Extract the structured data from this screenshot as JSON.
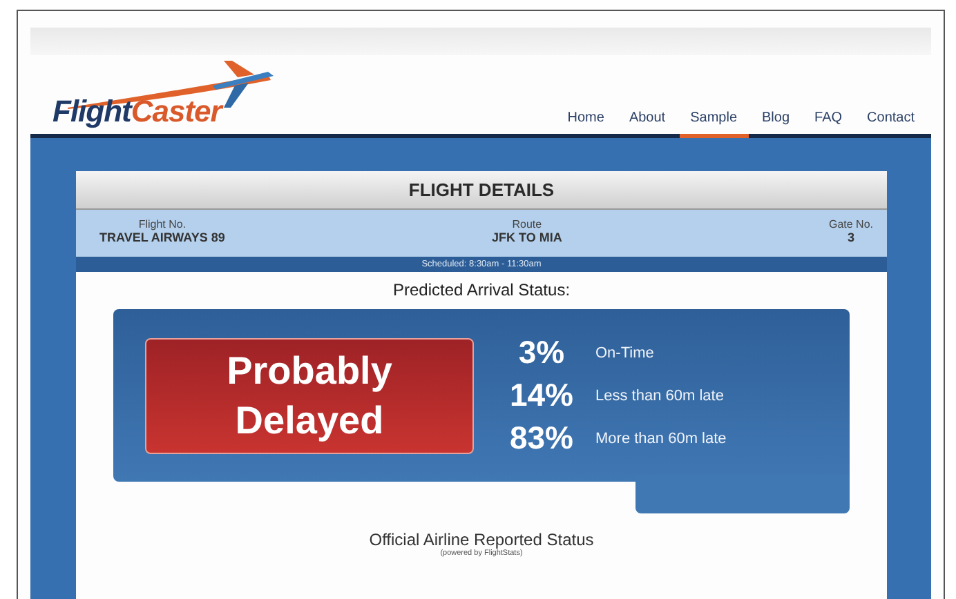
{
  "logo": {
    "part_1": "Flight",
    "part_2": "Caster"
  },
  "nav": [
    {
      "label": "Home",
      "selected": false
    },
    {
      "label": "About",
      "selected": false
    },
    {
      "label": "Sample",
      "selected": true
    },
    {
      "label": "Blog",
      "selected": false
    },
    {
      "label": "FAQ",
      "selected": false
    },
    {
      "label": "Contact",
      "selected": false
    }
  ],
  "details": {
    "title": "FLIGHT DETAILS",
    "fields": [
      {
        "label": "Flight No.",
        "value": "TRAVEL AIRWAYS 89"
      },
      {
        "label": "Route",
        "value": "JFK TO MIA"
      },
      {
        "label": "Gate No.",
        "value": "3"
      }
    ],
    "scheduled": "Scheduled: 8:30am - 11:30am"
  },
  "prediction": {
    "heading": "Predicted Arrival Status:",
    "verdict": "Probably Delayed",
    "rows": [
      {
        "percent": "3%",
        "label": "On-Time"
      },
      {
        "percent": "14%",
        "label": "Less than 60m late"
      },
      {
        "percent": "83%",
        "label": "More than 60m late"
      }
    ]
  },
  "official": {
    "heading": "Official Airline Reported Status",
    "credit": "(powered by FlightStats)"
  }
}
